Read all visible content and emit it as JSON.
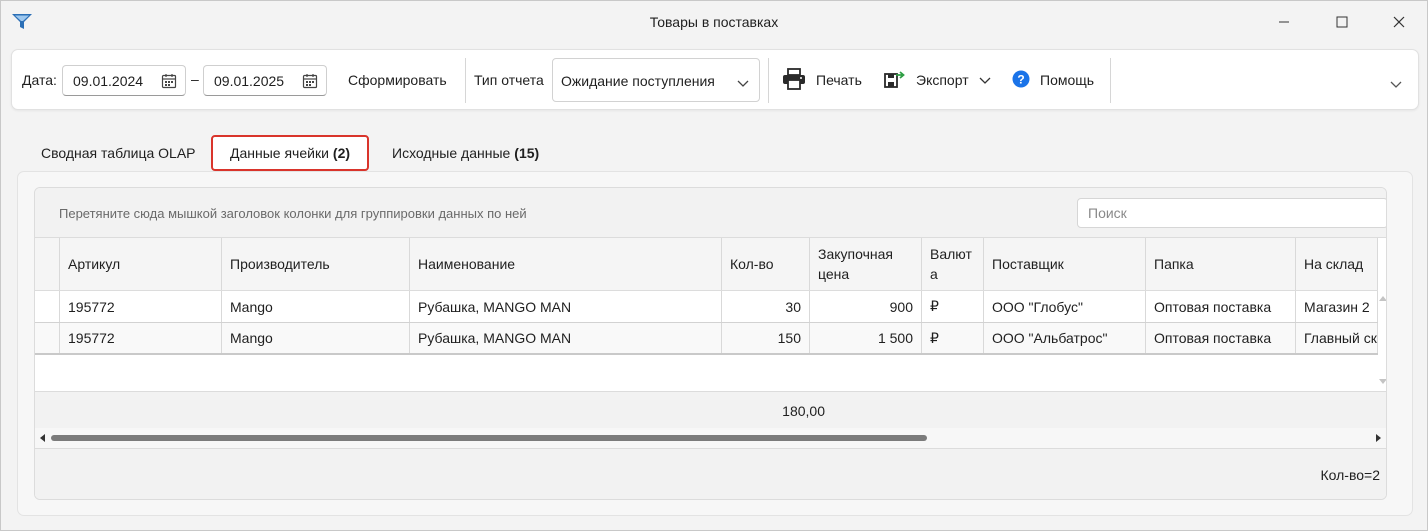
{
  "window": {
    "title": "Товары в поставках"
  },
  "toolbar": {
    "date_label": "Дата:",
    "date_from": "09.01.2024",
    "date_separator": "–",
    "date_to": "09.01.2025",
    "generate_label": "Сформировать",
    "report_type_label": "Тип отчета",
    "report_type_value": "Ожидание поступления",
    "print_label": "Печать",
    "export_label": "Экспорт",
    "help_label": "Помощь"
  },
  "tabs": [
    {
      "label": "Сводная таблица OLAP",
      "count": ""
    },
    {
      "label": "Данные ячейки",
      "count": "(2)",
      "active": true
    },
    {
      "label": "Исходные данные",
      "count": "(15)"
    }
  ],
  "grid": {
    "group_hint": "Перетяните сюда мышкой заголовок колонки для группировки данных по ней",
    "search_placeholder": "Поиск",
    "columns": [
      "Артикул",
      "Производитель",
      "Наименование",
      "Кол-во",
      "Закупочная цена",
      "Валюта",
      "Поставщик",
      "Папка",
      "На склад"
    ],
    "rows": [
      [
        "195772",
        "Mango",
        "Рубашка, MANGO MAN",
        "30",
        "900",
        "₽",
        "ООО \"Глобус\"",
        "Оптовая поставка",
        "Магазин 2"
      ],
      [
        "195772",
        "Mango",
        "Рубашка, MANGO MAN",
        "150",
        "1 500",
        "₽",
        "ООО \"Альбатрос\"",
        "Оптовая поставка",
        "Главный склад"
      ]
    ],
    "summary_qty": "180,00",
    "footer_text": "Кол-во=2"
  },
  "colors": {
    "active_tab_border": "#d9342b",
    "help_icon": "#1a73e8",
    "export_arrow": "#2e9e44"
  }
}
